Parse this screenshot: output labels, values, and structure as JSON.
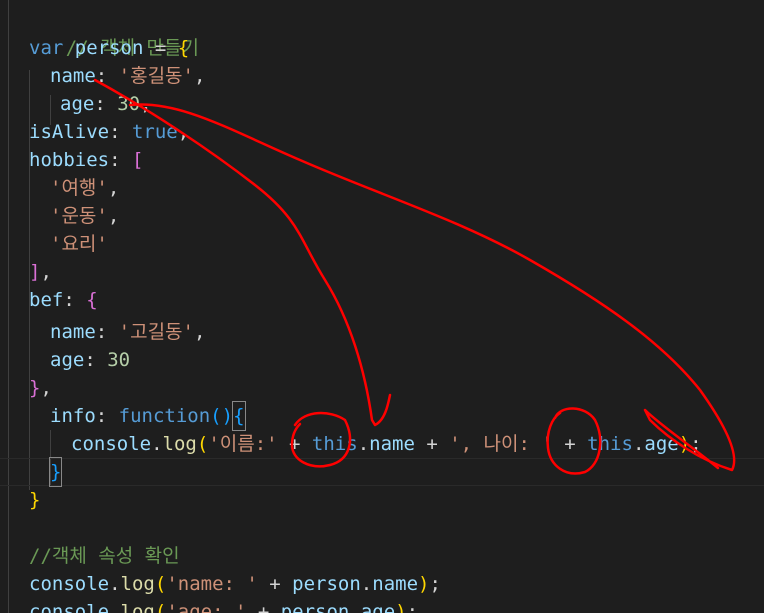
{
  "code": {
    "l1": {
      "comment": "// 객체 만들기"
    },
    "l2": {
      "kw": "var",
      "name": "person",
      "eq": " = ",
      "brace": "{"
    },
    "l3": {
      "key": "name",
      "colon": ": ",
      "val": "'홍길동'",
      "comma": ","
    },
    "l4": {
      "key": "age",
      "colon": ": ",
      "val": "30",
      "comma": ","
    },
    "l5": {
      "key": "isAlive",
      "colon": ": ",
      "val": "true",
      "comma": ","
    },
    "l6": {
      "key": "hobbies",
      "colon": ": ",
      "bracket": "["
    },
    "l7": {
      "val": "'여행'",
      "comma": ","
    },
    "l8": {
      "val": "'운동'",
      "comma": ","
    },
    "l9": {
      "val": "'요리'"
    },
    "l10": {
      "bracket": "]",
      "comma": ","
    },
    "l11": {
      "key": "bef",
      "colon": ": ",
      "brace": "{"
    },
    "l12": {
      "key": "name",
      "colon": ": ",
      "val": "'고길동'",
      "comma": ","
    },
    "l13": {
      "key": "age",
      "colon": ": ",
      "val": "30"
    },
    "l14": {
      "brace": "}",
      "comma": ","
    },
    "l15": {
      "key": "info",
      "colon": ": ",
      "kw": "function",
      "parens": "()",
      "brace": "{"
    },
    "l16": {
      "obj": "console",
      "dot1": ".",
      "method": "log",
      "open": "(",
      "str1": "'이름:'",
      "plus1": " + ",
      "this1": "this",
      "dot2": ".",
      "prop1": "name",
      "plus2": " + ",
      "str2": "', 나이: '",
      "plus3": " + ",
      "this2": "this",
      "dot3": ".",
      "prop2": "age",
      "close": ")",
      "semi": ";"
    },
    "l17": {
      "brace": "}"
    },
    "l18": {
      "brace": "}"
    },
    "l20": {
      "comment": "//객체 속성 확인"
    },
    "l21": {
      "obj": "console",
      "dot": ".",
      "method": "log",
      "open": "(",
      "str": "'name: '",
      "plus": " + ",
      "var": "person",
      "dot2": ".",
      "prop": "name",
      "close": ")",
      "semi": ";"
    },
    "l22": {
      "obj": "console",
      "dot": ".",
      "method": "log",
      "open": "(",
      "str": "'age: '",
      "plus": " + ",
      "var": "person",
      "dot2": ".",
      "prop": "age",
      "close": ")",
      "semi": ";"
    }
  },
  "colors": {
    "background": "#1e1e1e",
    "annotation": "#ff0000"
  }
}
